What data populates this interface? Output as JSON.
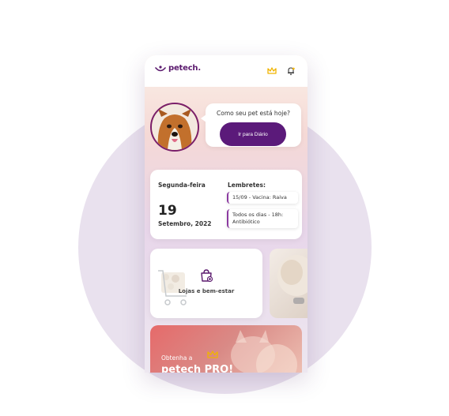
{
  "app": {
    "logo_text": "petech."
  },
  "hero": {
    "question": "Como seu pet está hoje?",
    "cta_label": "Ir para Diário"
  },
  "date_card": {
    "day_name": "Segunda-feira",
    "day_number": "19",
    "month_year": "Setembro, 2022",
    "reminders_title": "Lembretes:",
    "reminders": [
      {
        "text": "15/09 - Vacina: Raiva"
      },
      {
        "text": "Todos os dias - 18h: Antibiótico"
      }
    ]
  },
  "shop_card": {
    "label": "Lojas e bem-estar"
  },
  "pro_card": {
    "line1": "Obtenha a",
    "line2": "petech PRO!"
  },
  "colors": {
    "brand": "#5b1a6e",
    "accent": "#f0b400",
    "cta": "#5b1a7a"
  },
  "icons": [
    "logo-mark-icon",
    "crown-icon",
    "bell-icon",
    "shopping-bag-icon",
    "cart-icon"
  ]
}
